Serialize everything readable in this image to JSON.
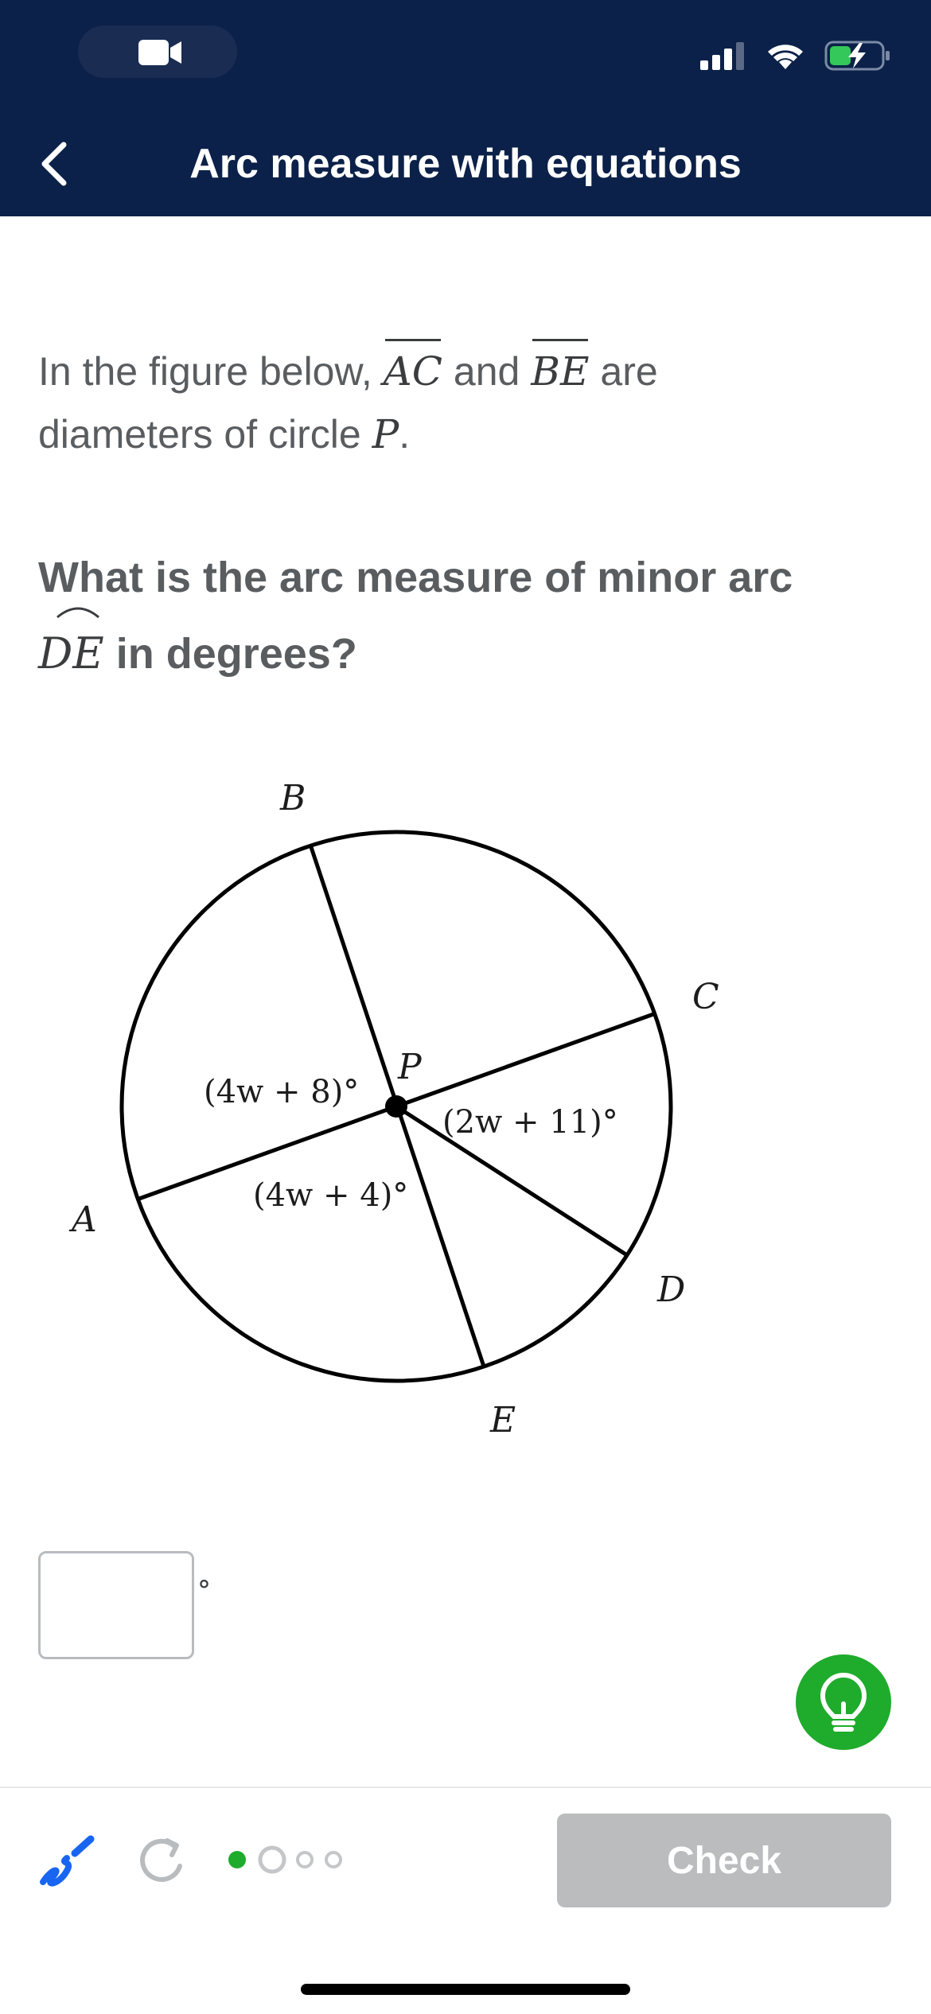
{
  "header": {
    "title": "Arc measure with equations",
    "back_icon": "chevron-left-icon"
  },
  "status_bar": {
    "camera_icon": "video-camera-icon",
    "signal_icon": "cellular-signal-icon",
    "wifi_icon": "wifi-icon",
    "battery_icon": "battery-charging-icon"
  },
  "question": {
    "intro_prefix": "In the figure below,",
    "segment_1": "AC",
    "intro_and": "and",
    "segment_2": "BE",
    "intro_are": "are",
    "intro_line2": "diameters of circle",
    "circle_name": "P",
    "period": ".",
    "prompt_prefix": "What is the arc measure of minor arc",
    "arc_name": "DE",
    "prompt_suffix": "in degrees?"
  },
  "figure": {
    "points": [
      "A",
      "B",
      "C",
      "D",
      "E",
      "P"
    ],
    "angle_labels": {
      "apb": "(4w + 8)°",
      "cpd": "(2w + 11)°",
      "ape": "(4w + 4)°"
    }
  },
  "answer": {
    "value": "",
    "unit": "°"
  },
  "toolbar": {
    "scratchpad_icon": "scratchpad-pencil-icon",
    "restart_icon": "restart-arrow-icon",
    "progress_total": 4,
    "progress_current": 1,
    "check_label": "Check",
    "hint_icon": "lightbulb-icon"
  },
  "colors": {
    "header_bg": "#0b2149",
    "hint_green": "#1fab2c",
    "check_disabled": "#babcbe",
    "scratch_blue": "#1865f2"
  }
}
